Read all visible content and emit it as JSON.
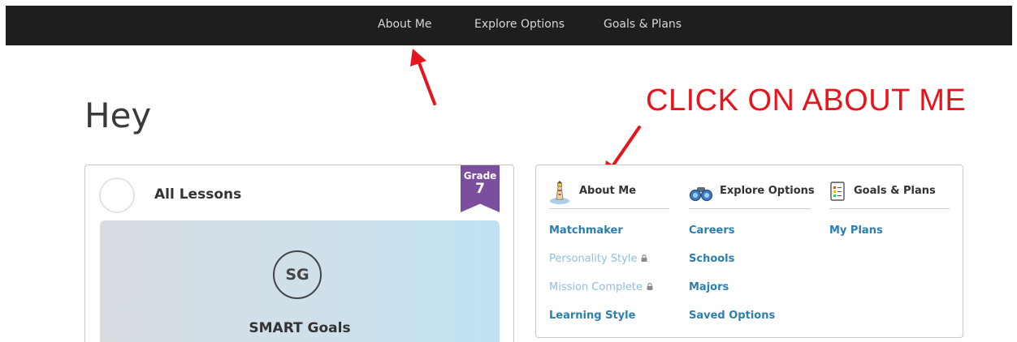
{
  "topnav": {
    "items": [
      "About Me",
      "Explore Options",
      "Goals & Plans"
    ]
  },
  "greeting": "Hey",
  "callout": "CLICK ON ABOUT ME",
  "lessons": {
    "title": "All Lessons",
    "grade_label": "Grade",
    "grade_value": "7",
    "tile_badge": "SG",
    "tile_title": "SMART Goals"
  },
  "menu": {
    "about": {
      "title": "About Me",
      "links": [
        "Matchmaker",
        "Personality Style",
        "Mission Complete",
        "Learning Style"
      ]
    },
    "explore": {
      "title": "Explore Options",
      "links": [
        "Careers",
        "Schools",
        "Majors",
        "Saved Options"
      ]
    },
    "goals": {
      "title": "Goals & Plans",
      "links": [
        "My Plans"
      ]
    }
  },
  "colors": {
    "accent_link": "#2a7fb2",
    "locked_link": "#8fc0de",
    "grade_badge": "#7b4f9e",
    "annotation": "#e8141b",
    "nav_bg": "#1e1e1e"
  }
}
